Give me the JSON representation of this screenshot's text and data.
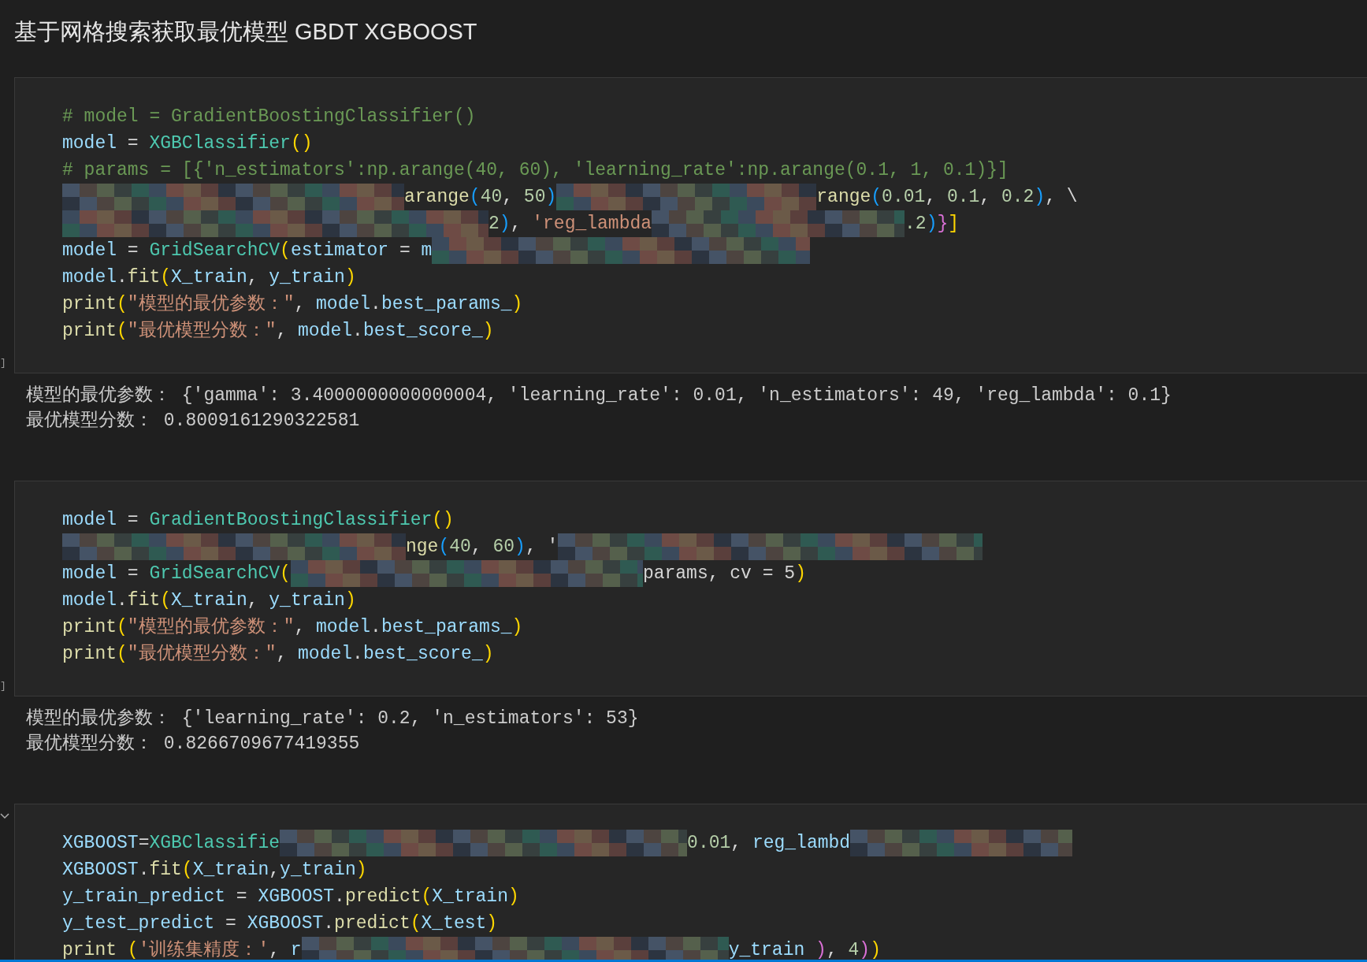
{
  "heading": "基于网格搜索获取最优模型 GBDT XGBOOST",
  "cells": [
    {
      "execution_label": "]",
      "collapse_toggle": false,
      "lines": [
        [
          {
            "kind": "comment",
            "text": "# model = GradientBoostingClassifier()"
          }
        ],
        [
          {
            "kind": "variable",
            "text": "model"
          },
          {
            "kind": "plain",
            "text": " = "
          },
          {
            "kind": "class",
            "text": "XGBClassifier"
          },
          {
            "kind": "bracket1",
            "text": "()"
          }
        ],
        [
          {
            "kind": "comment",
            "text": "# params = [{'n_estimators':np.arange(40, 60), 'learning_rate':np.arange(0.1, 1, 0.1)}]"
          }
        ],
        [
          {
            "kind": "mosaic"
          },
          {
            "kind": "function",
            "text": "arange"
          },
          {
            "kind": "bracket3",
            "text": "("
          },
          {
            "kind": "number",
            "text": "40"
          },
          {
            "kind": "plain",
            "text": ", "
          },
          {
            "kind": "number",
            "text": "50"
          },
          {
            "kind": "bracket3",
            "text": ")"
          },
          {
            "kind": "mosaic"
          },
          {
            "kind": "function",
            "text": "range"
          },
          {
            "kind": "bracket3",
            "text": "("
          },
          {
            "kind": "number",
            "text": "0.01"
          },
          {
            "kind": "plain",
            "text": ", "
          },
          {
            "kind": "number",
            "text": "0.1"
          },
          {
            "kind": "plain",
            "text": ", "
          },
          {
            "kind": "number",
            "text": "0.2"
          },
          {
            "kind": "bracket3",
            "text": ")"
          },
          {
            "kind": "plain",
            "text": ", \\"
          }
        ],
        [
          {
            "kind": "mosaic"
          },
          {
            "kind": "number",
            "text": "2"
          },
          {
            "kind": "bracket3",
            "text": ")"
          },
          {
            "kind": "plain",
            "text": ", "
          },
          {
            "kind": "string",
            "text": "'reg_lambda"
          },
          {
            "kind": "mosaic"
          },
          {
            "kind": "number",
            "text": ".2"
          },
          {
            "kind": "bracket3",
            "text": ")"
          },
          {
            "kind": "bracket2",
            "text": "}"
          },
          {
            "kind": "bracket1",
            "text": "]"
          }
        ],
        [
          {
            "kind": "variable",
            "text": "model"
          },
          {
            "kind": "plain",
            "text": " = "
          },
          {
            "kind": "class",
            "text": "GridSearchCV"
          },
          {
            "kind": "bracket1",
            "text": "("
          },
          {
            "kind": "variable",
            "text": "estimator"
          },
          {
            "kind": "plain",
            "text": " = "
          },
          {
            "kind": "variable",
            "text": "m"
          },
          {
            "kind": "mosaic"
          }
        ],
        [
          {
            "kind": "variable",
            "text": "model"
          },
          {
            "kind": "plain",
            "text": "."
          },
          {
            "kind": "function",
            "text": "fit"
          },
          {
            "kind": "bracket1",
            "text": "("
          },
          {
            "kind": "variable",
            "text": "X_train"
          },
          {
            "kind": "plain",
            "text": ", "
          },
          {
            "kind": "variable",
            "text": "y_train"
          },
          {
            "kind": "bracket1",
            "text": ")"
          }
        ],
        [
          {
            "kind": "function",
            "text": "print"
          },
          {
            "kind": "bracket1",
            "text": "("
          },
          {
            "kind": "string",
            "text": "\"模型的最优参数：\""
          },
          {
            "kind": "plain",
            "text": ", "
          },
          {
            "kind": "variable",
            "text": "model"
          },
          {
            "kind": "plain",
            "text": "."
          },
          {
            "kind": "variable",
            "text": "best_params_"
          },
          {
            "kind": "bracket1",
            "text": ")"
          }
        ],
        [
          {
            "kind": "function",
            "text": "print"
          },
          {
            "kind": "bracket1",
            "text": "("
          },
          {
            "kind": "string",
            "text": "\"最优模型分数：\""
          },
          {
            "kind": "plain",
            "text": ", "
          },
          {
            "kind": "variable",
            "text": "model"
          },
          {
            "kind": "plain",
            "text": "."
          },
          {
            "kind": "variable",
            "text": "best_score_"
          },
          {
            "kind": "bracket1",
            "text": ")"
          }
        ]
      ],
      "output": [
        "模型的最优参数： {'gamma': 3.4000000000000004, 'learning_rate': 0.01, 'n_estimators': 49, 'reg_lambda': 0.1}",
        "最优模型分数： 0.8009161290322581"
      ]
    },
    {
      "execution_label": "]",
      "collapse_toggle": false,
      "lines": [
        [
          {
            "kind": "variable",
            "text": "model"
          },
          {
            "kind": "plain",
            "text": " = "
          },
          {
            "kind": "class",
            "text": "GradientBoostingClassifier"
          },
          {
            "kind": "bracket1",
            "text": "()"
          }
        ],
        [
          {
            "kind": "mosaic"
          },
          {
            "kind": "function",
            "text": "nge"
          },
          {
            "kind": "bracket3",
            "text": "("
          },
          {
            "kind": "number",
            "text": "40"
          },
          {
            "kind": "plain",
            "text": ", "
          },
          {
            "kind": "number",
            "text": "60"
          },
          {
            "kind": "bracket3",
            "text": ")"
          },
          {
            "kind": "plain",
            "text": ", '"
          },
          {
            "kind": "mosaic"
          }
        ],
        [
          {
            "kind": "variable",
            "text": "model"
          },
          {
            "kind": "plain",
            "text": " = "
          },
          {
            "kind": "class",
            "text": "GridSearchCV"
          },
          {
            "kind": "bracket1",
            "text": "("
          },
          {
            "kind": "mosaic"
          },
          {
            "kind": "plain",
            "text": "params, cv = 5"
          },
          {
            "kind": "bracket1",
            "text": ")"
          }
        ],
        [
          {
            "kind": "variable",
            "text": "model"
          },
          {
            "kind": "plain",
            "text": "."
          },
          {
            "kind": "function",
            "text": "fit"
          },
          {
            "kind": "bracket1",
            "text": "("
          },
          {
            "kind": "variable",
            "text": "X_train"
          },
          {
            "kind": "plain",
            "text": ", "
          },
          {
            "kind": "variable",
            "text": "y_train"
          },
          {
            "kind": "bracket1",
            "text": ")"
          }
        ],
        [
          {
            "kind": "function",
            "text": "print"
          },
          {
            "kind": "bracket1",
            "text": "("
          },
          {
            "kind": "string",
            "text": "\"模型的最优参数：\""
          },
          {
            "kind": "plain",
            "text": ", "
          },
          {
            "kind": "variable",
            "text": "model"
          },
          {
            "kind": "plain",
            "text": "."
          },
          {
            "kind": "variable",
            "text": "best_params_"
          },
          {
            "kind": "bracket1",
            "text": ")"
          }
        ],
        [
          {
            "kind": "function",
            "text": "print"
          },
          {
            "kind": "bracket1",
            "text": "("
          },
          {
            "kind": "string",
            "text": "\"最优模型分数：\""
          },
          {
            "kind": "plain",
            "text": ", "
          },
          {
            "kind": "variable",
            "text": "model"
          },
          {
            "kind": "plain",
            "text": "."
          },
          {
            "kind": "variable",
            "text": "best_score_"
          },
          {
            "kind": "bracket1",
            "text": ")"
          }
        ]
      ],
      "output": [
        "模型的最优参数： {'learning_rate': 0.2, 'n_estimators': 53}",
        "最优模型分数： 0.8266709677419355"
      ]
    },
    {
      "collapse_toggle": true,
      "lines": [
        [
          {
            "kind": "variable",
            "text": "XGBOOST"
          },
          {
            "kind": "plain",
            "text": "="
          },
          {
            "kind": "class",
            "text": "XGBClassifie"
          },
          {
            "kind": "mosaic"
          },
          {
            "kind": "number",
            "text": "0.01"
          },
          {
            "kind": "plain",
            "text": ", "
          },
          {
            "kind": "variable",
            "text": "reg_lambd"
          },
          {
            "kind": "mosaic"
          }
        ],
        [
          {
            "kind": "variable",
            "text": "XGBOOST"
          },
          {
            "kind": "plain",
            "text": "."
          },
          {
            "kind": "function",
            "text": "fit"
          },
          {
            "kind": "bracket1",
            "text": "("
          },
          {
            "kind": "variable",
            "text": "X_train"
          },
          {
            "kind": "plain",
            "text": ","
          },
          {
            "kind": "variable",
            "text": "y_train"
          },
          {
            "kind": "bracket1",
            "text": ")"
          }
        ],
        [
          {
            "kind": "variable",
            "text": "y_train_predict"
          },
          {
            "kind": "plain",
            "text": " = "
          },
          {
            "kind": "variable",
            "text": "XGBOOST"
          },
          {
            "kind": "plain",
            "text": "."
          },
          {
            "kind": "function",
            "text": "predict"
          },
          {
            "kind": "bracket1",
            "text": "("
          },
          {
            "kind": "variable",
            "text": "X_train"
          },
          {
            "kind": "bracket1",
            "text": ")"
          }
        ],
        [
          {
            "kind": "variable",
            "text": "y_test_predict"
          },
          {
            "kind": "plain",
            "text": " = "
          },
          {
            "kind": "variable",
            "text": "XGBOOST"
          },
          {
            "kind": "plain",
            "text": "."
          },
          {
            "kind": "function",
            "text": "predict"
          },
          {
            "kind": "bracket1",
            "text": "("
          },
          {
            "kind": "variable",
            "text": "X_test"
          },
          {
            "kind": "bracket1",
            "text": ")"
          }
        ],
        [
          {
            "kind": "function",
            "text": "print"
          },
          {
            "kind": "bracket1",
            "text": " ("
          },
          {
            "kind": "string",
            "text": "'训练集精度：'"
          },
          {
            "kind": "plain",
            "text": ", "
          },
          {
            "kind": "variable",
            "text": "r"
          },
          {
            "kind": "mosaic"
          },
          {
            "kind": "variable",
            "text": "y_train"
          },
          {
            "kind": "bracket2",
            "text": " )"
          },
          {
            "kind": "plain",
            "text": ", "
          },
          {
            "kind": "number",
            "text": "4"
          },
          {
            "kind": "bracket2",
            "text": ")"
          },
          {
            "kind": "bracket1",
            "text": ")"
          }
        ]
      ]
    }
  ]
}
